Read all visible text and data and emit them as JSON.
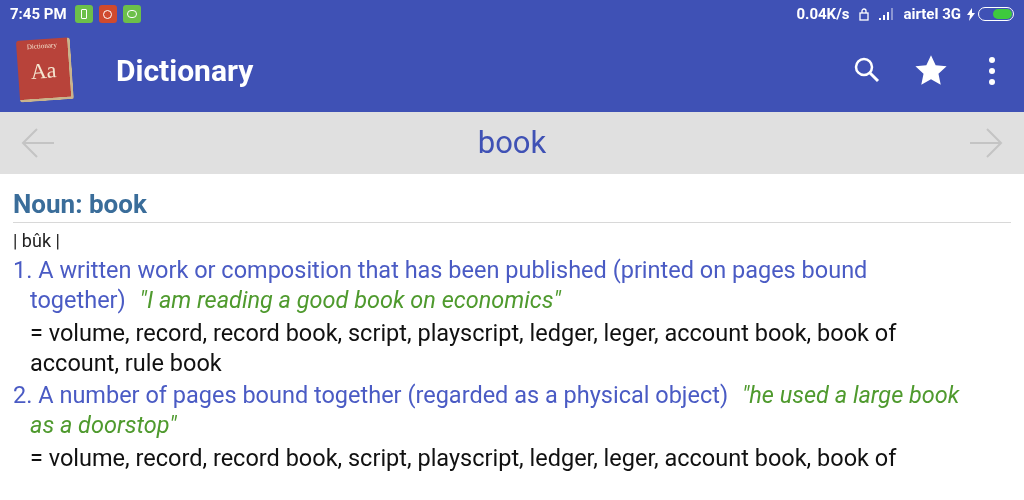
{
  "status_bar": {
    "time": "7:45 PM",
    "speed": "0.04K/s",
    "carrier": "airtel 3G",
    "charging": true
  },
  "app_bar": {
    "logo": {
      "top": "Dictionary",
      "letters": "Aa"
    },
    "title": "Dictionary"
  },
  "nav": {
    "word": "book"
  },
  "entry": {
    "heading": "Noun: book",
    "pronunciation": "| bûk |",
    "senses": [
      {
        "number": "1.",
        "definition": "A written work or composition that has been published (printed on pages bound together)",
        "example": "\"I am reading a good book on economics\"",
        "synonyms": "= volume, record, record book, script, playscript, ledger, leger, account book, book of account, rule book"
      },
      {
        "number": "2.",
        "definition": "A number of pages bound together (regarded as a physical object)",
        "example": "\"he used a large book as a doorstop\"",
        "synonyms": "= volume, record, record book, script, playscript, ledger, leger, account book, book of"
      }
    ]
  }
}
